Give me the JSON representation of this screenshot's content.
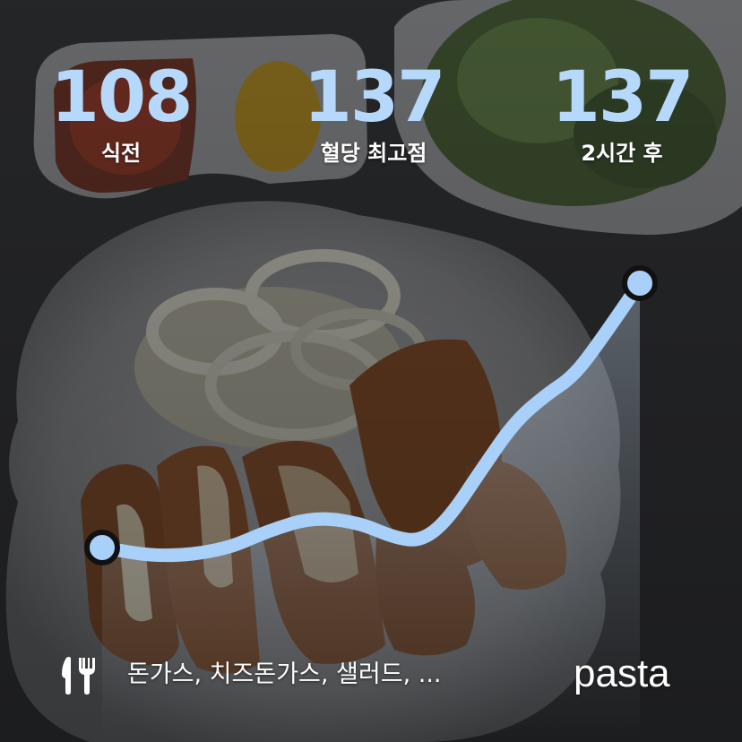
{
  "stats": {
    "before": {
      "value": "108",
      "label": "식전"
    },
    "peak": {
      "value": "137",
      "label": "혈당 최고점"
    },
    "after": {
      "value": "137",
      "label": "2시간 후"
    }
  },
  "meal": {
    "icon": "fork-knife-icon",
    "foods": "돈가스, 치즈돈가스, 샐러드, ..."
  },
  "brand": "pasta",
  "colors": {
    "accent": "#b5d8fb",
    "curve": "#a9d0f8",
    "text": "#ffffff",
    "background": "#2a2b2d"
  }
}
